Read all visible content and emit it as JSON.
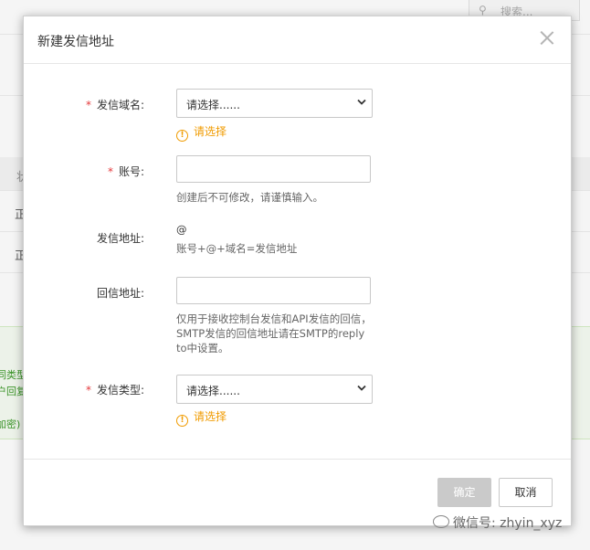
{
  "background": {
    "search_placeholder": "搜索...",
    "table_header_fragment": "状",
    "row1_fragment": "正",
    "row2_fragment": "正",
    "green_lines": [
      "同类型",
      "户回复",
      "加密)"
    ]
  },
  "modal": {
    "title": "新建发信地址",
    "fields": {
      "domain": {
        "label": "发信域名:",
        "required_mark": "*",
        "selected": "请选择......",
        "warning": "请选择"
      },
      "account": {
        "label": "账号:",
        "required_mark": "*",
        "value": "",
        "hint": "创建后不可修改，请谨慎输入。"
      },
      "address": {
        "label": "发信地址:",
        "value": "@",
        "hint": "账号+@+域名=发信地址"
      },
      "reply": {
        "label": "回信地址:",
        "value": "",
        "hint": "仅用于接收控制台发信和API发信的回信，SMTP发信的回信地址请在SMTP的reply to中设置。"
      },
      "type": {
        "label": "发信类型:",
        "required_mark": "*",
        "selected": "请选择......",
        "warning": "请选择"
      }
    },
    "buttons": {
      "confirm": "确定",
      "cancel": "取消"
    }
  },
  "watermark": "微信号: zhyin_xyz",
  "colors": {
    "required": "#e4393c",
    "warning": "#f09b00",
    "disabled_button": "#cacaca"
  }
}
